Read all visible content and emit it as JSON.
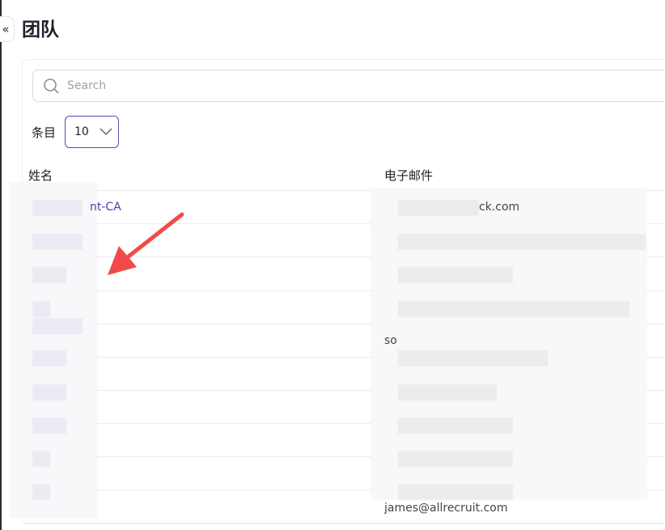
{
  "page": {
    "title": "团队"
  },
  "sidebar": {
    "collapse_icon": "double-chevron-left-icon",
    "collapse_glyph": "«"
  },
  "search": {
    "placeholder": "Search",
    "value": ""
  },
  "entries": {
    "label": "条目",
    "selected": "10"
  },
  "table": {
    "headers": {
      "name": "姓名",
      "email": "电子邮件"
    },
    "rows": [
      {
        "name": "nt-CA",
        "email": "ck.com"
      },
      {
        "name": "",
        "email": ""
      },
      {
        "name": "",
        "email": ""
      },
      {
        "name": "",
        "email": ""
      },
      {
        "name": "",
        "email": "so"
      },
      {
        "name": "",
        "email": ""
      },
      {
        "name": "",
        "email": ""
      },
      {
        "name": "",
        "email": ""
      },
      {
        "name": "",
        "email": ""
      },
      {
        "name": "",
        "email": ""
      },
      {
        "name": "",
        "email": "james@allrecruit.com"
      }
    ]
  },
  "colors": {
    "accent": "#4d3fae",
    "annotation_arrow": "#f24a4a"
  }
}
